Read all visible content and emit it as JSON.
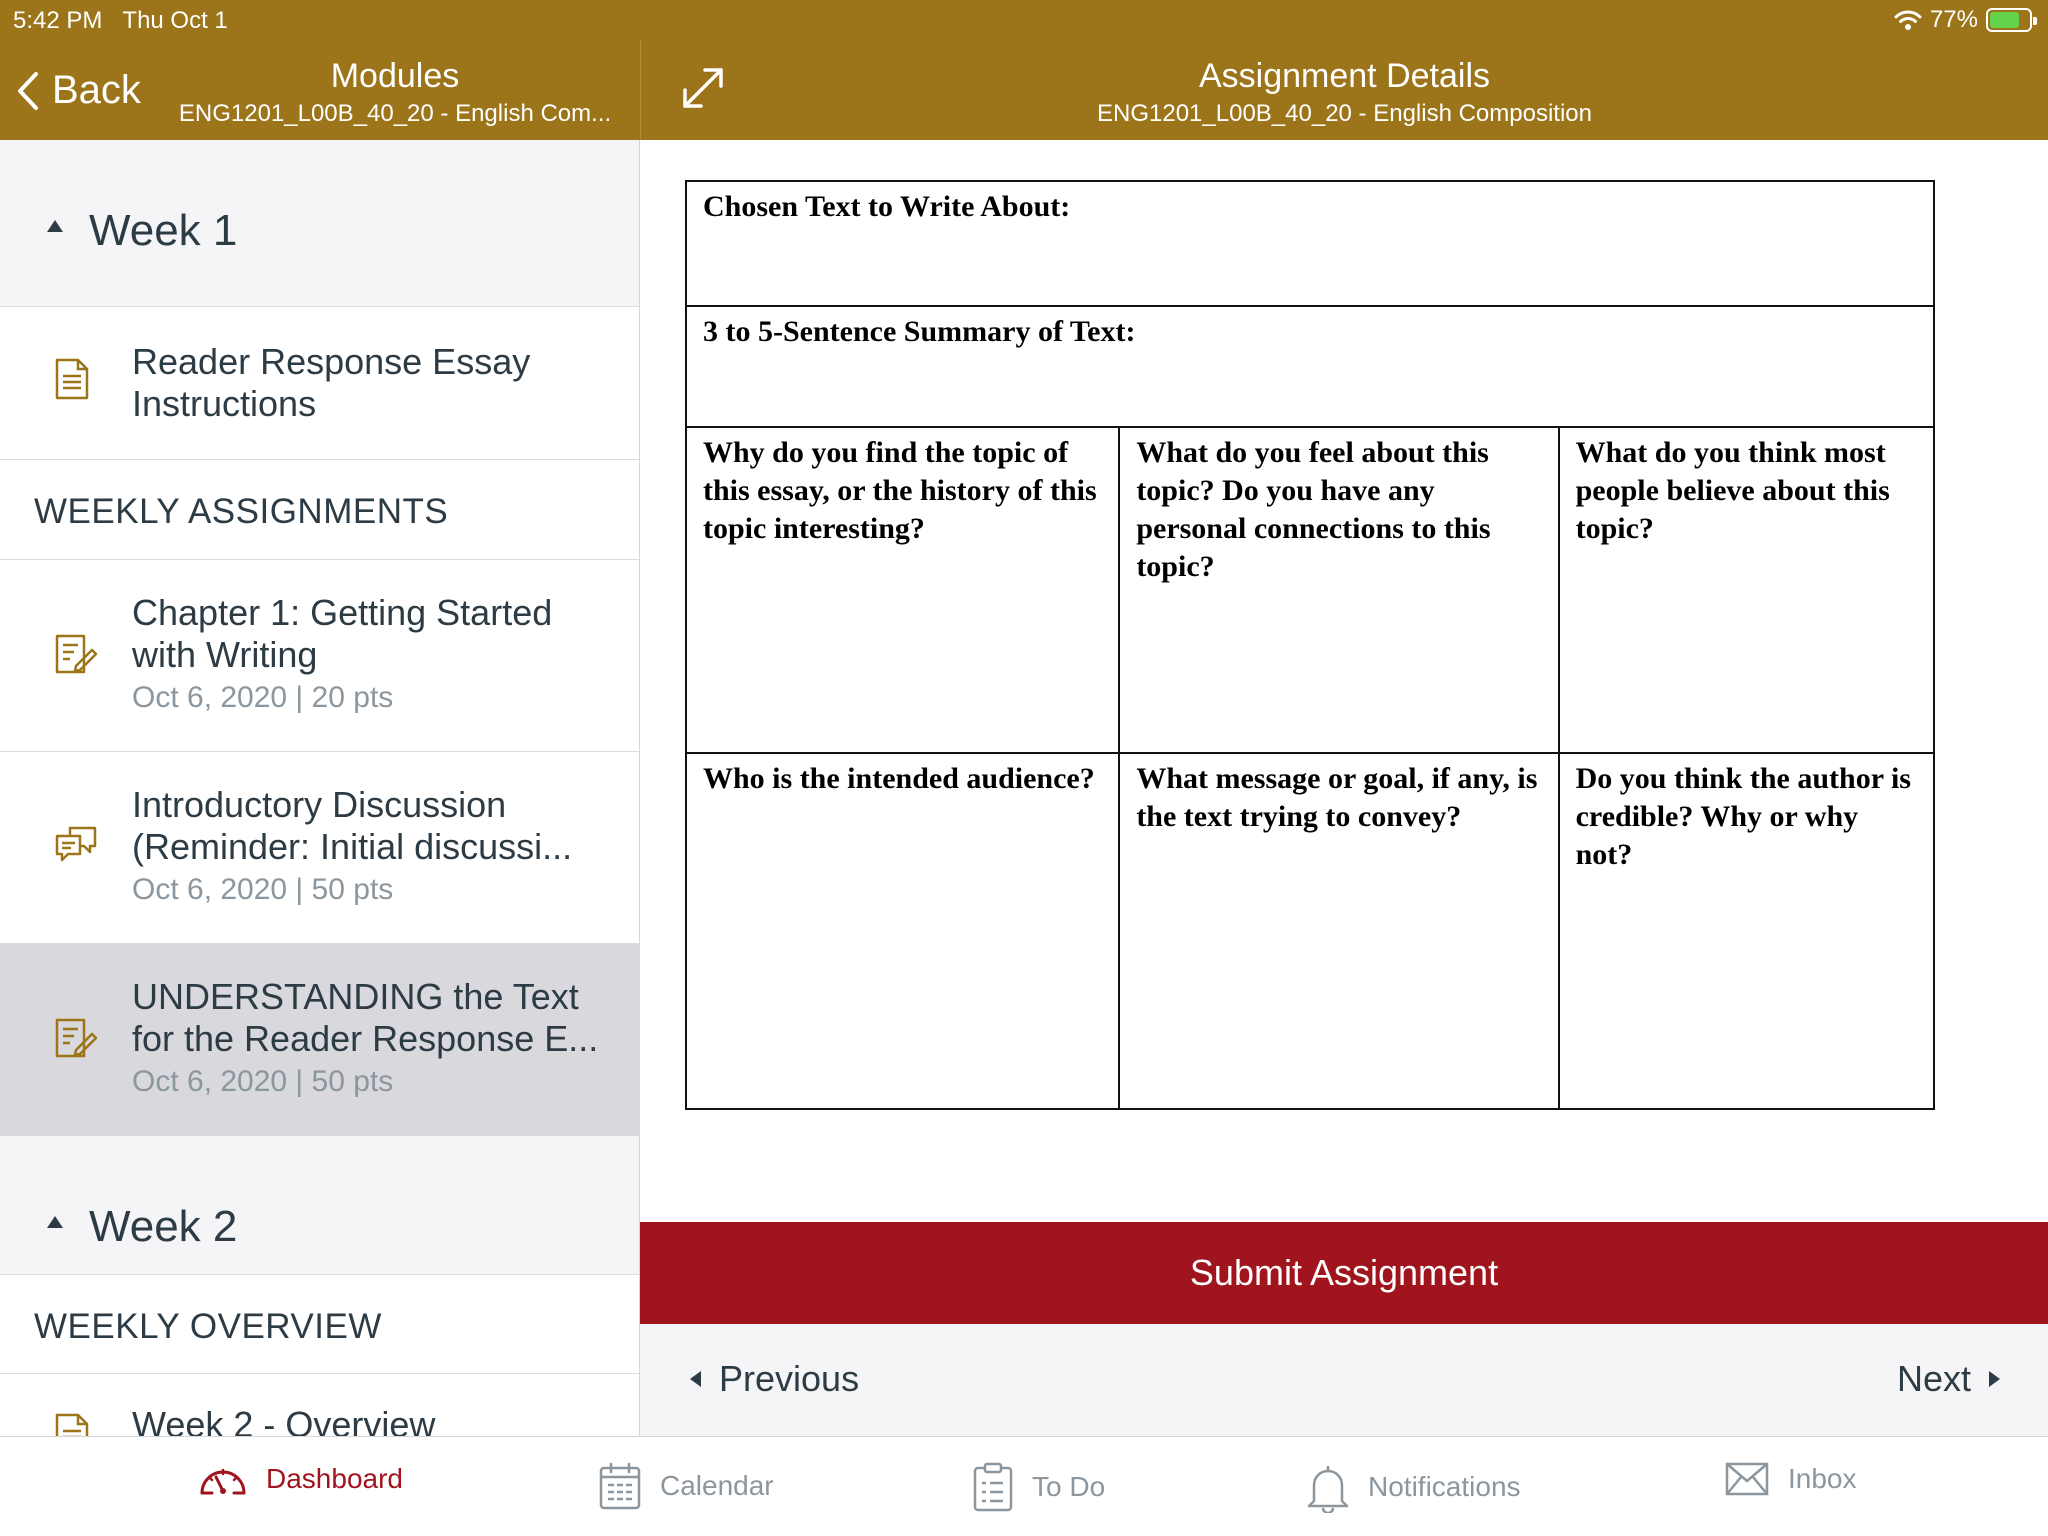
{
  "status": {
    "time": "5:42 PM",
    "date": "Thu Oct 1",
    "battery": "77%",
    "battery_level": 0.77
  },
  "nav": {
    "back_label": "Back",
    "left_title": "Modules",
    "left_subtitle": "ENG1201_L00B_40_20 - English Com...",
    "right_title": "Assignment Details",
    "right_subtitle": "ENG1201_L00B_40_20 - English Composition"
  },
  "modules": {
    "week1": {
      "label": "Week 1",
      "item_essay": {
        "title": "Reader Response Essay Instructions"
      },
      "section_weekly_assignments": "WEEKLY ASSIGNMENTS",
      "assignments": [
        {
          "title": "Chapter 1: Getting Started with Writing",
          "meta": "Oct 6, 2020 | 20 pts"
        },
        {
          "title": "Introductory Discussion (Reminder: Initial discussi...",
          "meta": "Oct 6, 2020 | 50 pts"
        },
        {
          "title": "UNDERSTANDING the Text for the Reader Response E...",
          "meta": "Oct 6, 2020 | 50 pts"
        }
      ]
    },
    "week2": {
      "label": "Week 2",
      "section_weekly_overview": "WEEKLY OVERVIEW",
      "item_overview": {
        "title": "Week 2 - Overview"
      }
    }
  },
  "worksheet": {
    "chosen_text": "Chosen Text to Write About:",
    "summary": "3 to 5-Sentence Summary of Text:",
    "q1": "Why do you find the topic of this essay, or the history of this topic interesting?",
    "q2": "What do you feel about this topic? Do you have any personal connections to this topic?",
    "q3": "What do you think most people believe about this topic?",
    "q4": "Who is the intended audience?",
    "q5": "What message or goal, if any, is the text trying to convey?",
    "q6": "Do you think the author is credible? Why or why not?"
  },
  "actions": {
    "submit": "Submit Assignment",
    "previous": "Previous",
    "next": "Next"
  },
  "tabs": {
    "dashboard": "Dashboard",
    "calendar": "Calendar",
    "todo": "To Do",
    "notifications": "Notifications",
    "inbox": "Inbox"
  },
  "colors": {
    "header": "#9c7419",
    "submit": "#a0141e",
    "active_tab": "#a0141e",
    "muted": "#8b969e"
  }
}
